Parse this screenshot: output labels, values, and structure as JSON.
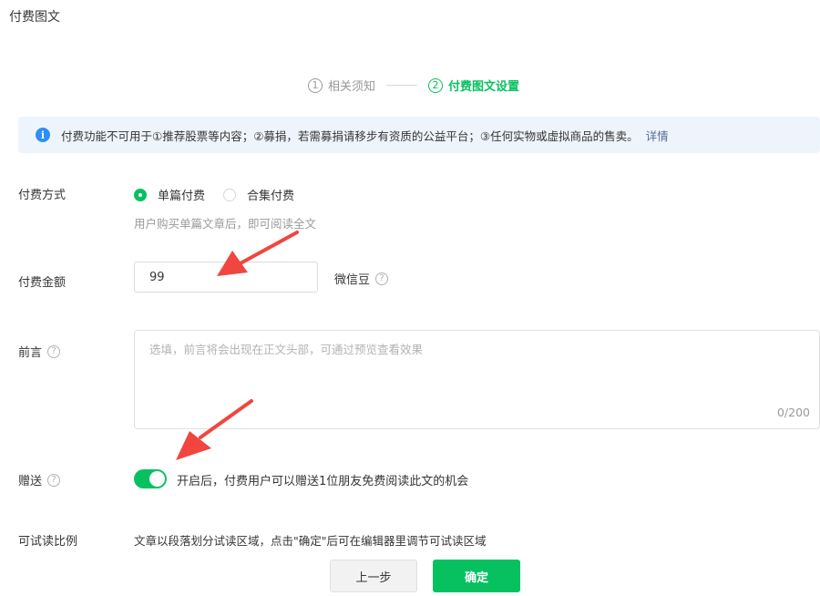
{
  "page": {
    "title": "付费图文"
  },
  "steps": [
    {
      "num": "1",
      "label": "相关须知",
      "active": false
    },
    {
      "num": "2",
      "label": "付费图文设置",
      "active": true
    }
  ],
  "notice": {
    "icon": "info-icon",
    "text": "付费功能不可用于①推荐股票等内容；②募捐，若需募捐请移步有资质的公益平台；③任何实物或虚拟商品的售卖。",
    "link": "详情"
  },
  "pay_method": {
    "label": "付费方式",
    "options": [
      {
        "label": "单篇付费",
        "checked": true
      },
      {
        "label": "合集付费",
        "checked": false
      }
    ],
    "hint": "用户购买单篇文章后，即可阅读全文"
  },
  "amount": {
    "label": "付费金额",
    "value": "99",
    "unit": "微信豆"
  },
  "preface": {
    "label": "前言",
    "placeholder": "选填，前言将会出现在正文头部，可通过预览查看效果",
    "counter": "0/200"
  },
  "gift": {
    "label": "赠送",
    "enabled": true,
    "text": "开启后，付费用户可以赠送1位朋友免费阅读此文的机会"
  },
  "trial": {
    "label": "可试读比例",
    "text": "文章以段落划分试读区域，点击\"确定\"后可在编辑器里调节可试读区域"
  },
  "buttons": {
    "prev": "上一步",
    "confirm": "确定"
  },
  "colors": {
    "accent": "#07c160",
    "info": "#2f8ef4",
    "annotation_arrow": "#f0463f"
  }
}
